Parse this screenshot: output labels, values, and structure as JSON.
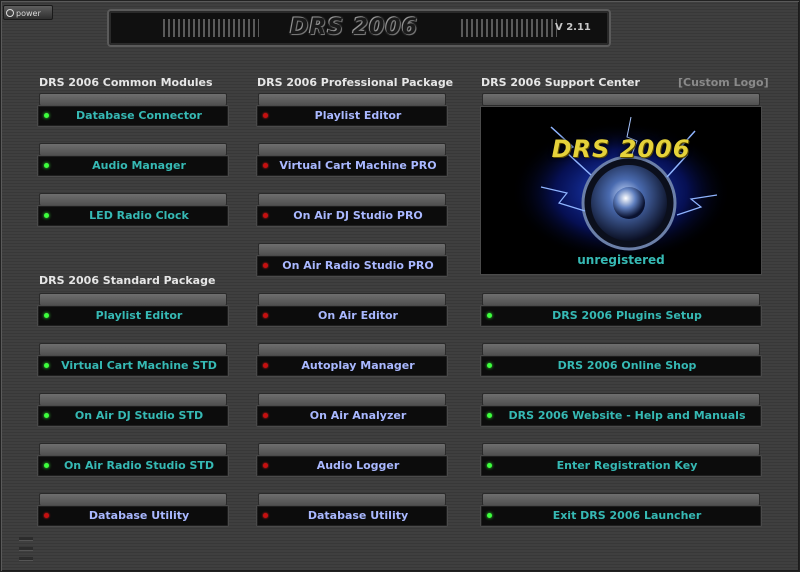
{
  "power": {
    "label": "power"
  },
  "header": {
    "title": "DRS 2006",
    "version": "V 2.11"
  },
  "sections": {
    "common": "DRS 2006 Common Modules",
    "standard": "DRS 2006 Standard Package",
    "professional": "DRS 2006 Professional Package",
    "support": "DRS 2006 Support Center",
    "custom_logo": "[Custom Logo]"
  },
  "common_modules": [
    {
      "label": "Database Connector",
      "status": "green"
    },
    {
      "label": "Audio Manager",
      "status": "green"
    },
    {
      "label": "LED Radio Clock",
      "status": "green"
    }
  ],
  "standard_modules": [
    {
      "label": "Playlist Editor",
      "status": "green"
    },
    {
      "label": "Virtual Cart Machine STD",
      "status": "green"
    },
    {
      "label": "On Air DJ Studio STD",
      "status": "green"
    },
    {
      "label": "On Air Radio Studio STD",
      "status": "green"
    },
    {
      "label": "Database Utility",
      "status": "red"
    }
  ],
  "professional_modules": [
    {
      "label": "Playlist Editor",
      "status": "red"
    },
    {
      "label": "Virtual Cart Machine PRO",
      "status": "red"
    },
    {
      "label": "On Air DJ Studio PRO",
      "status": "red"
    },
    {
      "label": "On Air Radio Studio PRO",
      "status": "red"
    },
    {
      "label": "On Air Editor",
      "status": "red"
    },
    {
      "label": "Autoplay Manager",
      "status": "red"
    },
    {
      "label": "On Air Analyzer",
      "status": "red"
    },
    {
      "label": "Audio Logger",
      "status": "red"
    },
    {
      "label": "Database Utility",
      "status": "red"
    }
  ],
  "support_links": [
    {
      "label": "DRS 2006 Plugins Setup",
      "status": "green"
    },
    {
      "label": "DRS 2006 Online Shop",
      "status": "green"
    },
    {
      "label": "DRS 2006 Website - Help and Manuals",
      "status": "green"
    },
    {
      "label": "Enter Registration Key",
      "status": "green"
    },
    {
      "label": "Exit DRS 2006 Launcher",
      "status": "green"
    }
  ],
  "logo": {
    "text": "DRS 2006",
    "status": "unregistered"
  },
  "colors": {
    "text_active": "#36b9b4",
    "text_locked": "#a9b8ff",
    "led_green": "#3dff3d",
    "led_red": "#c51010"
  }
}
